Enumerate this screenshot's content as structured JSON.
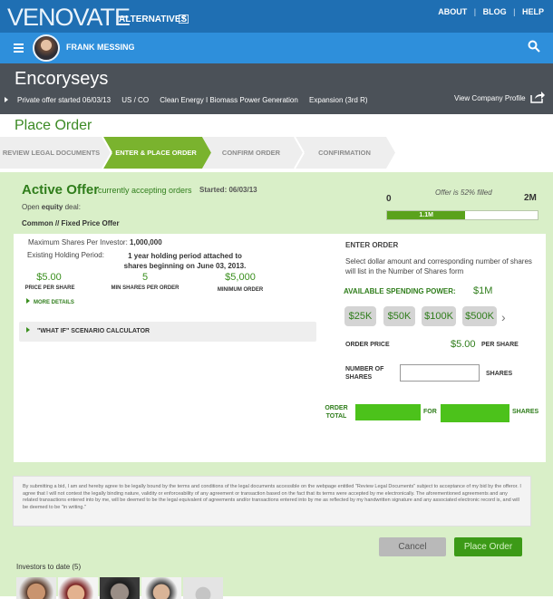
{
  "header": {
    "brand": "VENOVATE",
    "brand_sub": "ALTERNATIVES",
    "dropdown_glyph": "▼",
    "links": [
      "ABOUT",
      "BLOG",
      "HELP"
    ],
    "separator": "|"
  },
  "user": {
    "name": "FRANK MESSING"
  },
  "company": {
    "name": "Encoryseys",
    "offer_started": "Private offer started 06/03/13",
    "location": "US / CO",
    "sector": "Clean Energy I  Biomass Power Generation",
    "stage": "Expansion  (3rd R)",
    "view_profile": "View Company Profile"
  },
  "page": {
    "title": "Place Order"
  },
  "steps": [
    {
      "label": "REVIEW LEGAL DOCUMENTS",
      "active": false
    },
    {
      "label": "ENTER & PLACE ORDER",
      "active": true
    },
    {
      "label": "CONFIRM ORDER",
      "active": false
    },
    {
      "label": "CONFIRMATION",
      "active": false
    }
  ],
  "offer": {
    "title": "Active Offer",
    "accepting": "currently accepting orders",
    "started_label": "Started:  06/03/13",
    "open_deal": "Open ",
    "open_deal_bold": "equity",
    "open_deal_suffix": " deal:",
    "deal_type": "Common // Fixed Price Offer",
    "fill_text": "Offer is 52% filled",
    "fill_min": "0",
    "fill_max": "2M",
    "fill_amount": "1.1M",
    "fill_fraction": 0.52
  },
  "details": {
    "max_shares_label": "Maximum Shares Per Investor: ",
    "max_shares_value": "1,000,000",
    "holding_label": "Existing Holding Period:",
    "holding_value": "1 year holding period attached to shares beginning on June 03, 2013.",
    "metrics": [
      {
        "value": "$5.00",
        "label": "PRICE PER SHARE"
      },
      {
        "value": "5",
        "label": "MIN SHARES PER ORDER"
      },
      {
        "value": "$5,000",
        "label": "MINIMUM ORDER"
      }
    ],
    "more_details": "MORE DETAILS",
    "whatif": "\"WHAT IF\" SCENARIO CALCULATOR"
  },
  "order": {
    "title": "ENTER ORDER",
    "description": "Select dollar amount and corresponding number of shares will list in the Number of Shares form",
    "spending_label": "AVAILABLE SPENDING POWER:",
    "spending_value": "$1M",
    "amounts": [
      "$25K",
      "$50K",
      "$100K",
      "$500K"
    ],
    "more_glyph": "›",
    "price_label": "ORDER PRICE",
    "price_value": "$5.00",
    "price_unit": "PER SHARE",
    "shares_label": "NUMBER OF SHARES",
    "shares_value": "",
    "shares_unit": "SHARES",
    "total_label": "ORDER TOTAL",
    "total_for": "FOR",
    "total_unit": "SHARES"
  },
  "legal": {
    "text": "By submitting a bid, I am and hereby agree to be legally bound by the terms and conditions of the legal documents accessible on the webpage entitled \"Review Legal Documents\" subject to acceptance of my bid by the offeror. I agree that I will not contest the legally binding nature, validity or enforceability of any agreement or transaction based on the fact that its terms were accepted by me electronically. The aforementioned agreements and any related transactions entered into by me, will be deemed to be the legal equivalent of agreements and/or transactions entered into by me as reflected by my handwritten signature and any associated electronic record is, and will be deemed to be \"in writing.\""
  },
  "actions": {
    "cancel": "Cancel",
    "place_order": "Place Order"
  },
  "investors": {
    "label": "Investors to date (5)"
  },
  "colors": {
    "topbar": "#1f6fb3",
    "userbar": "#2e8fdb",
    "companybar": "#4b5158",
    "accent_green": "#3a8f1e",
    "main_bg": "#d9efc8"
  }
}
